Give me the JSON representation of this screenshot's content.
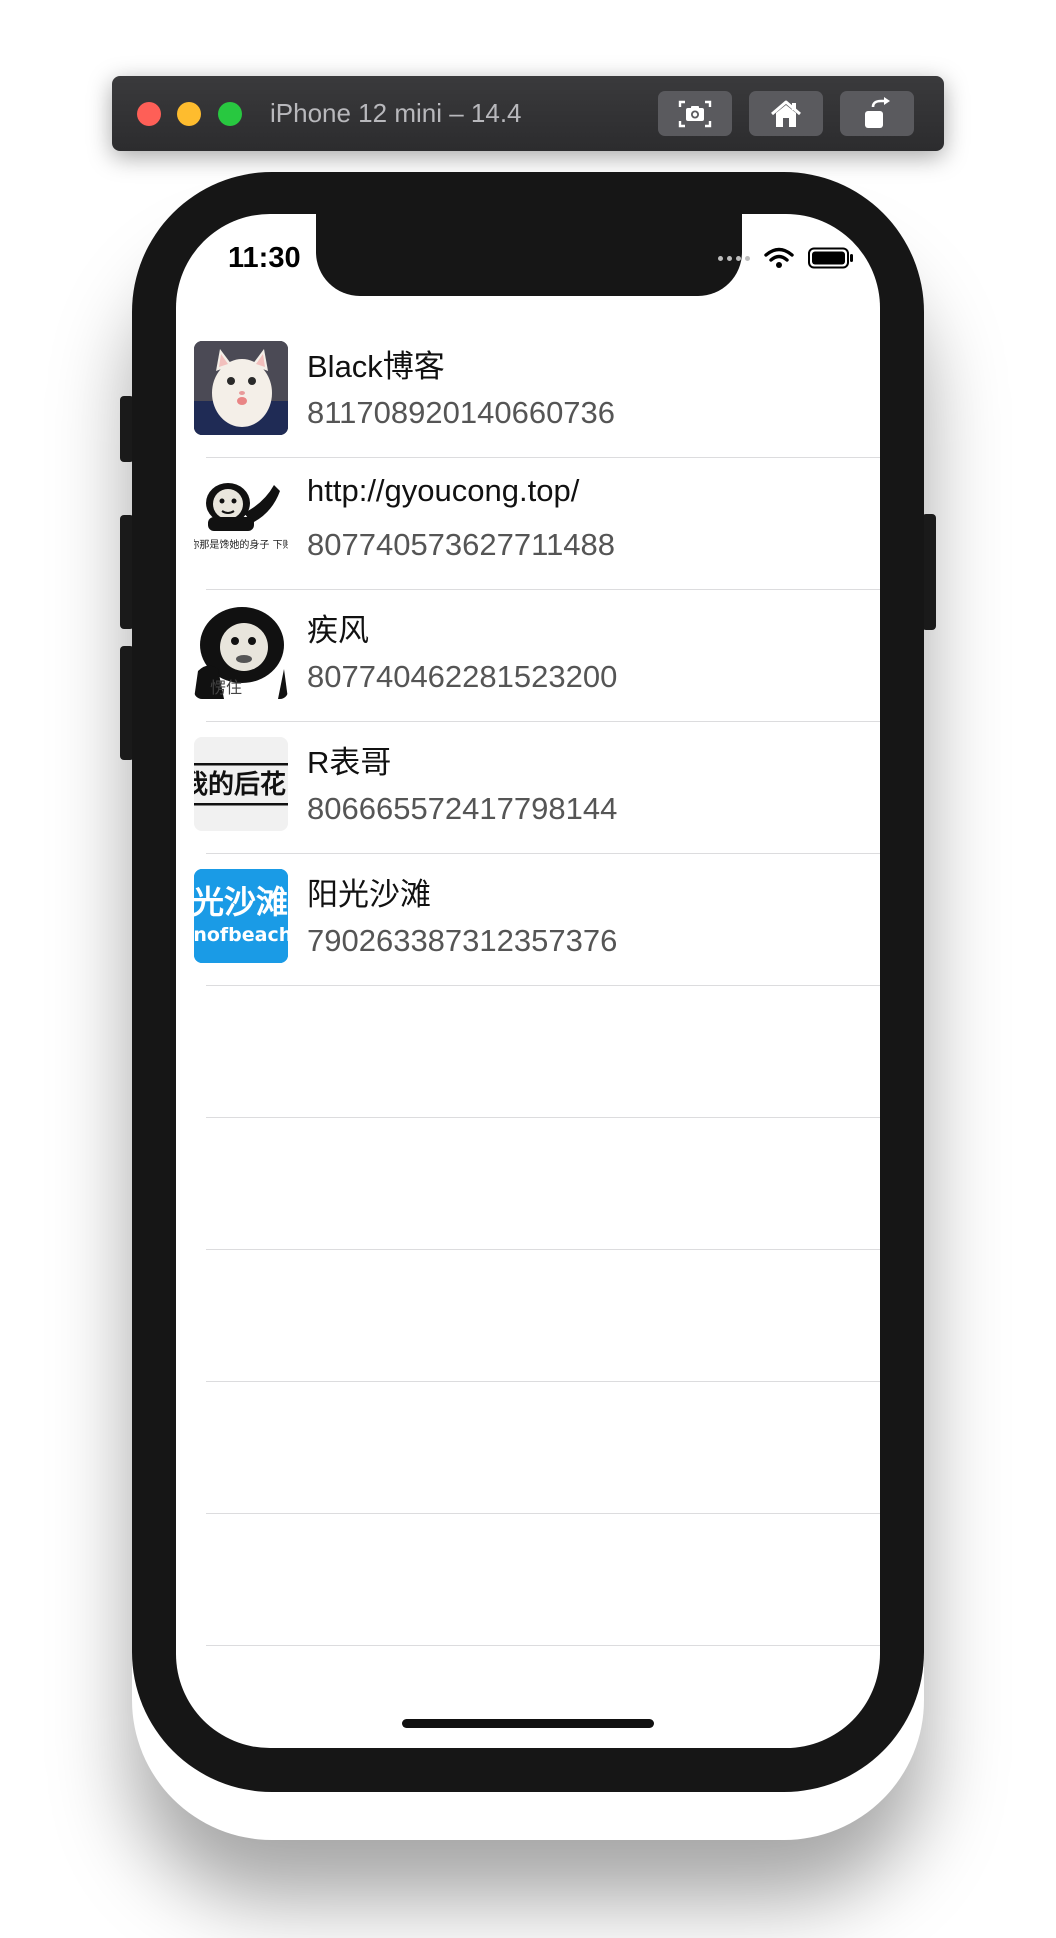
{
  "simulator": {
    "title": "iPhone 12 mini – 14.4",
    "buttons": [
      {
        "icon": "camera-icon"
      },
      {
        "icon": "home-icon"
      },
      {
        "icon": "rotate-icon"
      }
    ]
  },
  "status_bar": {
    "time": "11:30"
  },
  "list": {
    "rows": [
      {
        "title": "Black博客",
        "subtitle": "811708920140660736",
        "thumb_icon": "cat-avatar"
      },
      {
        "title": "http://gyoucong.top/",
        "subtitle": "807740573627711488",
        "thumb_icon": "panda-meme-avatar",
        "thumb_text": "你那是馋她的身子 下贱"
      },
      {
        "title": "疾风",
        "subtitle": "807740462281523200",
        "thumb_icon": "panda-meme-avatar",
        "thumb_text": "愣住"
      },
      {
        "title": "R表哥",
        "subtitle": "806665572417798144",
        "thumb_icon": "text-banner-avatar",
        "thumb_text": "我的后花"
      },
      {
        "title": "阳光沙滩",
        "subtitle": "790263387312357376",
        "thumb_icon": "blue-banner-avatar",
        "thumb_text": "阳光沙滩",
        "thumb_text2": "sunofbeach."
      },
      {
        "title": "",
        "subtitle": ""
      },
      {
        "title": "",
        "subtitle": ""
      },
      {
        "title": "",
        "subtitle": ""
      },
      {
        "title": "",
        "subtitle": ""
      },
      {
        "title": "",
        "subtitle": ""
      }
    ]
  },
  "colors": {
    "separator": "#dcdcde",
    "accent_blue": "#1a9be6"
  }
}
